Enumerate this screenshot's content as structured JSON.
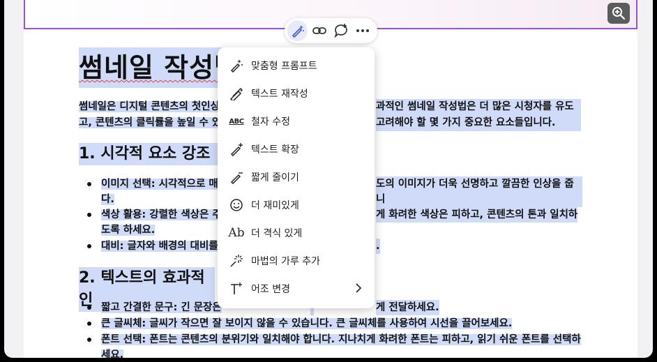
{
  "document": {
    "title": "썸네일 작성법",
    "intro": "썸네일은 디지털 콘텐츠의 첫인상을 결정하는 중요한 요소입니다. 효과적인 썸네일 작성법은 더 많은 시청자를 유도하고, 콘텐츠의 클릭률을 높일 수 있습니다. 썸네일을 제작할 때 고려해야 할 몇 가지 중요한 요소들입니다.",
    "intro_line1_left": "썸네일은 디지털 콘텐츠의 첫인상",
    "intro_line1_right": "과적인 썸네일 작성법은 더 많은 시청자를 유도하",
    "intro_line2_left": "고, 콘텐츠의 클릭률을 높일 수 있",
    "intro_line2_right": "고려해야 할 몇 가지 중요한 요소들입니다.",
    "section1": {
      "heading": "1. 시각적 요소 강조",
      "bullets": [
        {
          "l1_left": "이미지 선택: 시각적으로 매",
          "l1_right": "도의 이미지가 더욱 선명하고 깔끔한 인상을 줍니",
          "l2": "다."
        },
        {
          "l1_left": "색상 활용: 강렬한 색상은 주",
          "l1_right": "게 화려한 색상은 피하고, 콘텐츠의 톤과 일치하",
          "l2": "도록 하세요."
        },
        {
          "l1_left": "대비: 글자와 배경의 대비를",
          "l1_right": "."
        }
      ]
    },
    "section2": {
      "heading": "2. 텍스트의 효과적인",
      "bullets": [
        {
          "left": "짧고 간결한 문구: 긴 문장은",
          "right": "게 전달하세요."
        },
        {
          "text": "큰 글씨체: 글씨가 작으면 잘 보이지 않을 수 있습니다. 큰 글씨체를 사용하여 시선을 끌어보세요."
        },
        {
          "text": "폰트 선택: 폰트는 콘텐츠의 분위기와 일치해야 합니다. 지나치게 화려한 폰트는 피하고, 읽기 쉬운 폰트를 선택하",
          "l2": "세요."
        }
      ]
    }
  },
  "toolbar": {
    "buttons": [
      {
        "name": "ai-magic-pen-icon",
        "active": true
      },
      {
        "name": "link-icon",
        "active": false
      },
      {
        "name": "comment-add-icon",
        "active": false
      },
      {
        "name": "more-icon",
        "active": false
      }
    ]
  },
  "ai_menu": {
    "items": [
      {
        "label": "맞춤형 프롬프트",
        "icon": "custom-prompt-icon"
      },
      {
        "label": "텍스트 재작성",
        "icon": "rewrite-icon"
      },
      {
        "label": "철자 수정",
        "icon": "spelling-icon"
      },
      {
        "label": "텍스트 확장",
        "icon": "expand-text-icon"
      },
      {
        "label": "짧게 줄이기",
        "icon": "shorten-icon"
      },
      {
        "label": "더 재미있게",
        "icon": "smiley-icon"
      },
      {
        "label": "더 격식 있게",
        "icon": "formal-icon"
      },
      {
        "label": "마법의 가루 추가",
        "icon": "sparkle-dust-icon"
      },
      {
        "label": "어조 변경",
        "icon": "tone-icon",
        "submenu": true
      }
    ],
    "spelling_glyph": "ABC",
    "formal_glyph": "Ab"
  },
  "colors": {
    "selection_highlight": "#cfdbf8",
    "frame_purple": "#9a4fd6",
    "accent_blue": "#3b5bdb"
  }
}
